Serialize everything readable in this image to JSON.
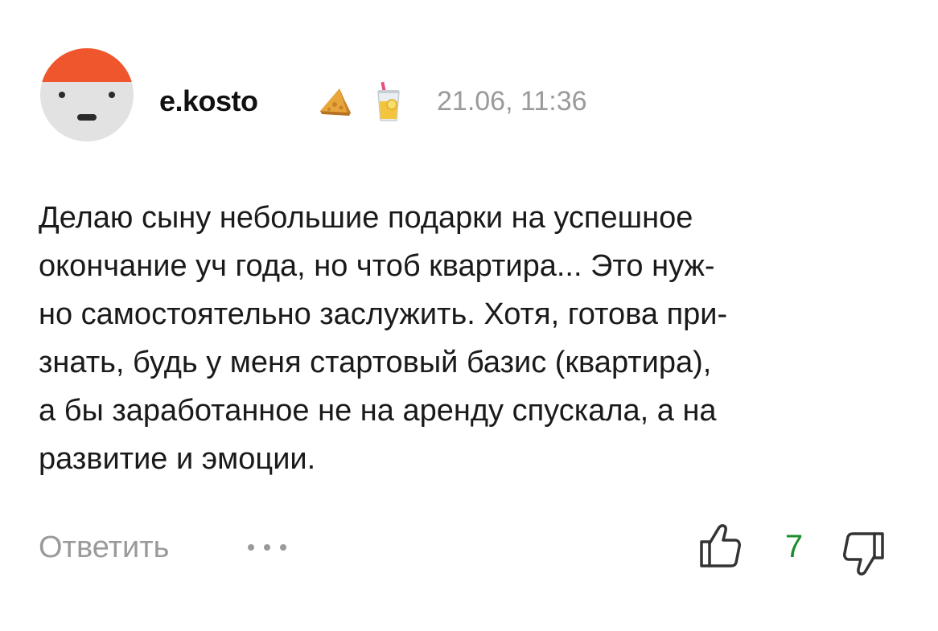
{
  "comment": {
    "author": "e.kosto",
    "timestamp": "21.06, 11:36",
    "avatar_icon": "smiling-face-with-orange-cap-icon",
    "badges": [
      "cheese-wedge-icon",
      "drink-glass-icon"
    ],
    "text": "Делаю сыну небольшие подарки на успешное окончание уч года, но чтоб квартира... Это нуж-­но самостоятельно заслужить. Хотя, готова при-­знать, будь у меня стартовый базис (квартира), а бы заработанное не на аренду спускала, а на развитие и эмоции.",
    "lines": [
      "Делаю сыну небольшие подарки на успешное",
      "окончание уч года, но чтоб квартира... Это нуж-",
      "но самостоятельно заслужить. Хотя, готова при-",
      "знать, будь у меня стартовый базис (квартира),",
      "а бы заработанное не на аренду спускала, а на",
      "развитие и эмоции."
    ]
  },
  "actions": {
    "reply_label": "Ответить",
    "more_icon": "more-dots-icon",
    "like_icon": "thumbs-up-icon",
    "like_count": "7",
    "dislike_icon": "thumbs-down-icon"
  },
  "colors": {
    "avatar_cap": "#f0562e",
    "avatar_face": "#e2e2e2",
    "muted_text": "#9a9a9a",
    "like_count": "#1a8f2a",
    "body_text": "#1a1a1a"
  }
}
